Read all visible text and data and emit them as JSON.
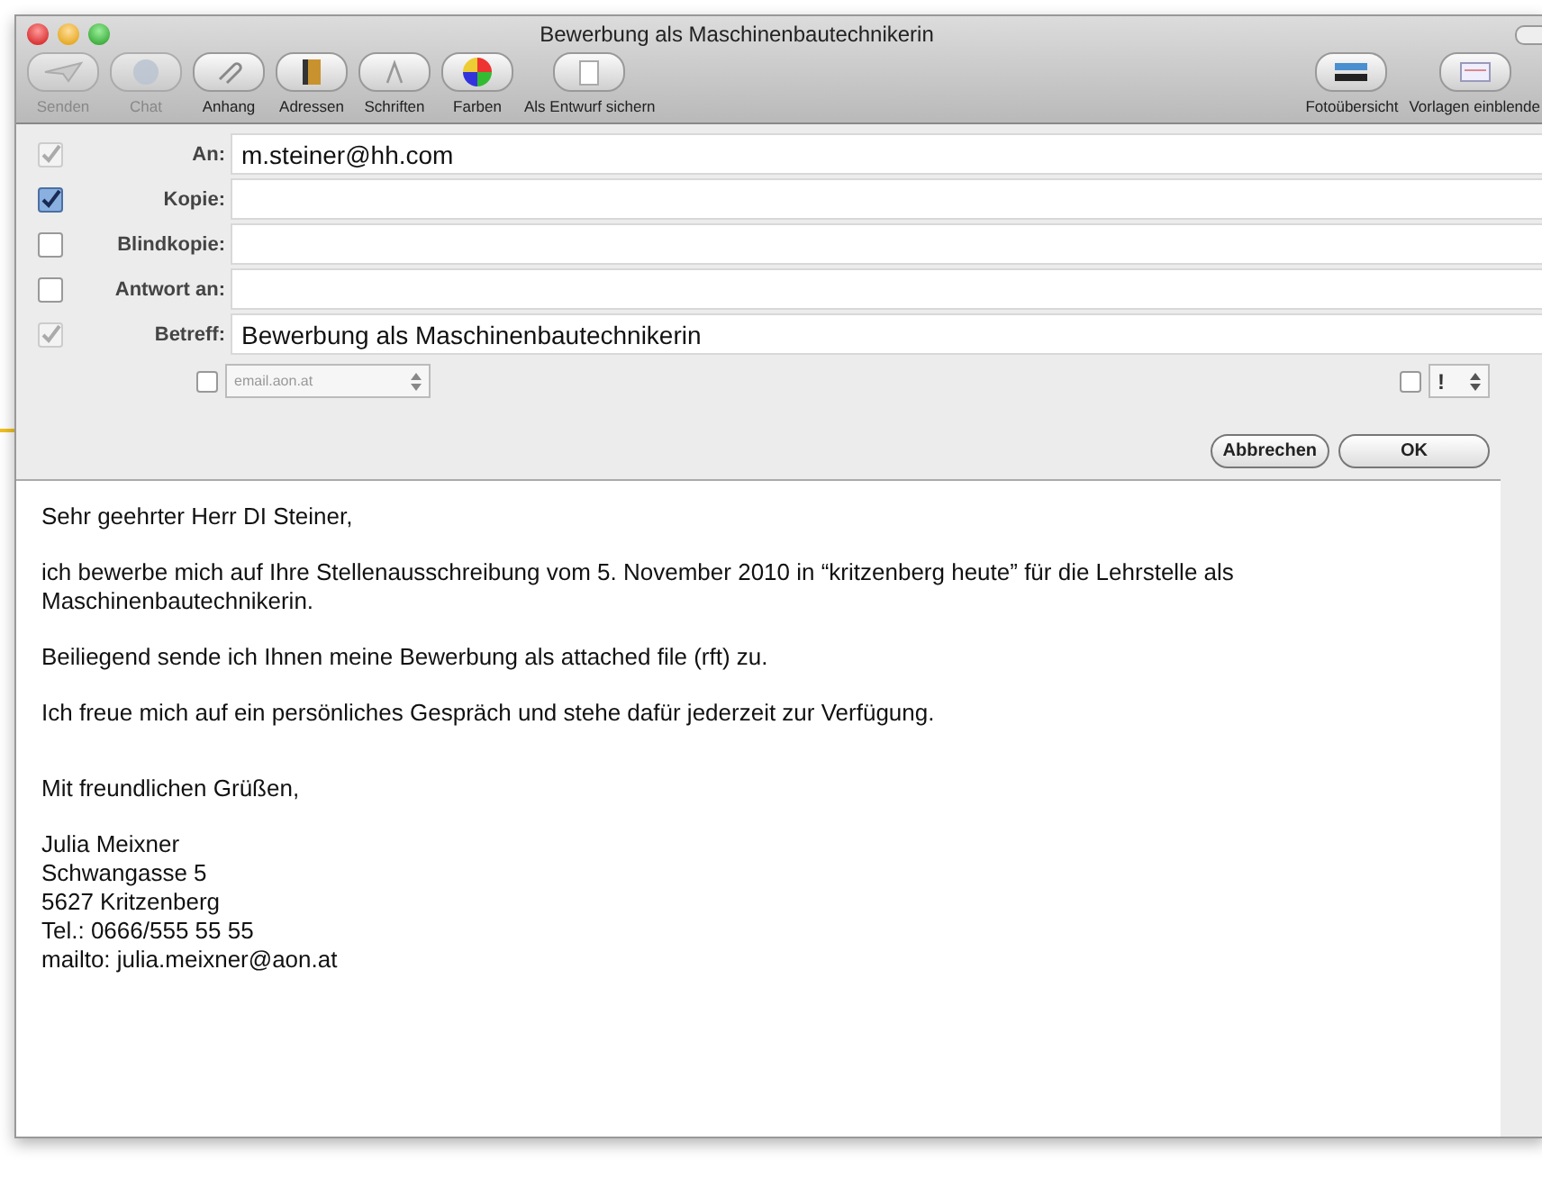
{
  "window": {
    "title": "Bewerbung als Maschinenbautechnikerin"
  },
  "toolbar": [
    {
      "label": "Senden",
      "disabled": true,
      "kind": "send"
    },
    {
      "label": "Chat",
      "disabled": true,
      "kind": "chat"
    },
    {
      "label": "Anhang",
      "disabled": false,
      "kind": "clip"
    },
    {
      "label": "Adressen",
      "disabled": false,
      "kind": "book"
    },
    {
      "label": "Schriften",
      "disabled": false,
      "kind": "font"
    },
    {
      "label": "Farben",
      "disabled": false,
      "kind": "colors"
    },
    {
      "label": "Als Entwurf sichern",
      "disabled": false,
      "kind": "draft"
    }
  ],
  "toolbar_right": [
    {
      "label": "Fotoübersicht",
      "kind": "photo"
    },
    {
      "label": "Vorlagen einblende",
      "kind": "template"
    }
  ],
  "header_fields": [
    {
      "label": "An:",
      "value": "m.steiner@hh.com",
      "checked": true,
      "disabled": true
    },
    {
      "label": "Kopie:",
      "checked": true,
      "disabled": false
    },
    {
      "label": "Blindkopie:",
      "checked": false,
      "disabled": false
    },
    {
      "label": "Antwort an:",
      "checked": false,
      "disabled": false
    },
    {
      "label": "Betreff:",
      "value": "Bewerbung als Maschinenbautechnikerin",
      "checked": true,
      "disabled": true
    }
  ],
  "account": {
    "checked": false,
    "value": "email.aon.at"
  },
  "priority": {
    "checked": false,
    "value": "!"
  },
  "buttons": [
    "Abbrechen",
    "OK"
  ],
  "body": {
    "paragraphs": [
      "Sehr geehrter Herr DI Steiner,",
      "ich bewerbe mich auf Ihre Stellenausschreibung vom 5. November 2010 in “kritzenberg heute” für die Lehrstelle als Maschinenbautechnikerin.",
      "Beiliegend sende ich Ihnen meine Bewerbung als attached file (rft) zu.",
      "Ich freue mich auf  ein persönliches Gespräch und stehe dafür jederzeit zur Verfügung."
    ],
    "closing": "Mit freundlichen Grüßen,",
    "signature": [
      "Julia Meixner",
      "Schwangasse 5",
      "5627 Kritzenberg",
      "Tel.: 0666/555 55 55",
      "mailto: julia.meixner@aon.at"
    ]
  }
}
